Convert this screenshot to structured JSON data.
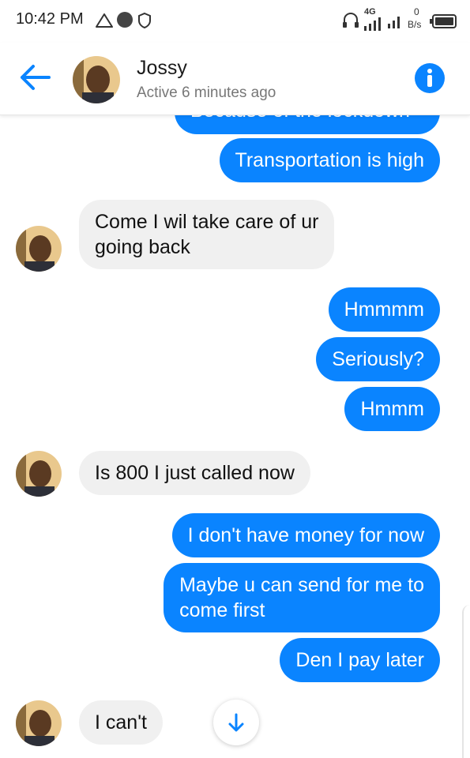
{
  "status_bar": {
    "time": "10:42 PM",
    "network": "4G",
    "data_speed_value": "0",
    "data_speed_unit": "B/s"
  },
  "header": {
    "contact_name": "Jossy",
    "contact_status": "Active 6 minutes ago",
    "back_icon": "arrow-left-icon",
    "info_icon": "info-icon"
  },
  "messages": [
    {
      "direction": "outgoing",
      "text": "Because of the lockdown",
      "partially_visible": true
    },
    {
      "direction": "outgoing",
      "text": "Transportation is high"
    },
    {
      "direction": "incoming",
      "lines": [
        "Come I wil take care of ur",
        "going back"
      ]
    },
    {
      "direction": "outgoing",
      "text": "Hmmmm"
    },
    {
      "direction": "outgoing",
      "text": "Seriously?"
    },
    {
      "direction": "outgoing",
      "text": "Hmmm"
    },
    {
      "direction": "incoming",
      "text": "Is 800 I just called now"
    },
    {
      "direction": "outgoing",
      "text": "I don't have money for now"
    },
    {
      "direction": "outgoing",
      "lines": [
        "Maybe u can send for me to",
        "come first"
      ]
    },
    {
      "direction": "outgoing",
      "text": "Den I pay later"
    },
    {
      "direction": "incoming",
      "text": "I can't"
    }
  ],
  "scroll_button": {
    "icon": "arrow-down-icon"
  },
  "colors": {
    "accent": "#0a84ff",
    "incoming_bubble": "#f0f0f0",
    "background": "#ffffff"
  }
}
